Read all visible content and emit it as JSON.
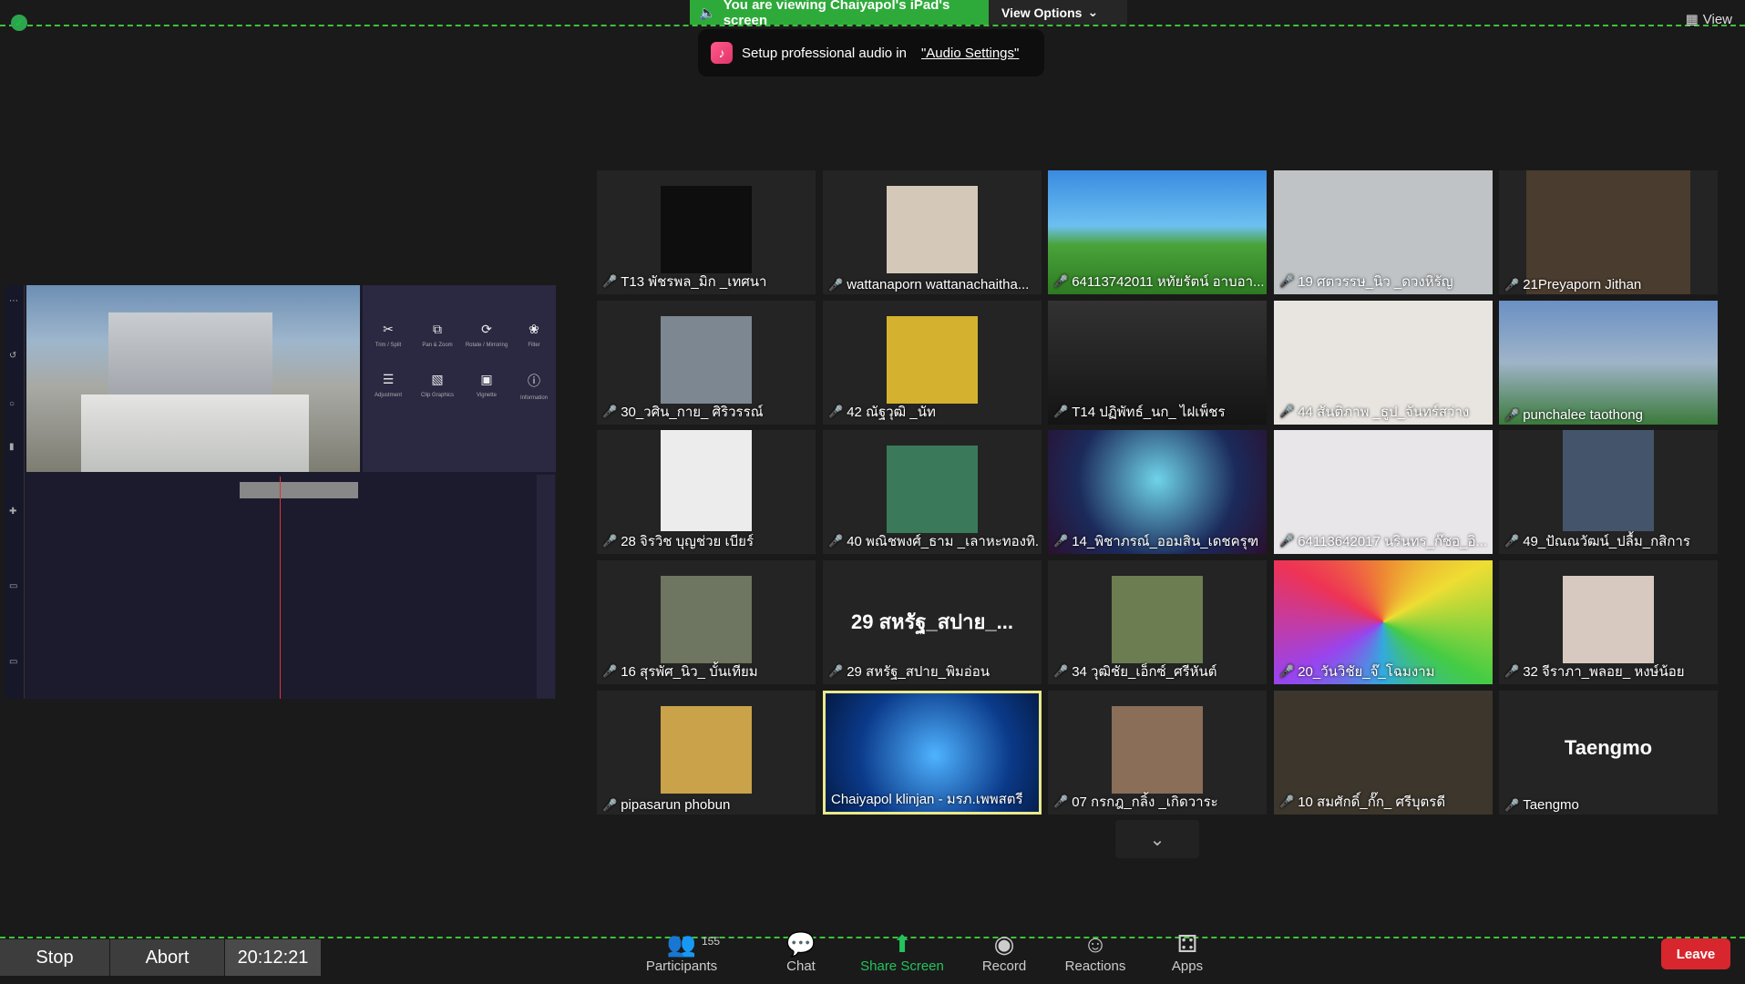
{
  "banner": {
    "viewing": "You are viewing Chaiyapol's iPad's screen",
    "view_options": "View Options"
  },
  "view_button": "View",
  "toast": {
    "text": "Setup professional audio in",
    "link": "\"Audio Settings\""
  },
  "participants_grid": [
    {
      "name": "T13 พัชรพล_มิก _เทศนา",
      "muted": true
    },
    {
      "name": "wattanaporn wattanachaitha...",
      "muted": true
    },
    {
      "name": "64113742011 หทัยรัตน์ อาบอา...",
      "muted": true
    },
    {
      "name": "19 ศตวรรษ_นิว _ดวงหิรัญ",
      "muted": true
    },
    {
      "name": "21Preyaporn Jithan",
      "muted": true
    },
    {
      "name": "30_วศิน_กาย_ ศิริวรรณ์",
      "muted": true
    },
    {
      "name": "42 ณัฐวุฒิ _นัท",
      "muted": true
    },
    {
      "name": "T14 ปฏิพัทธ์_นก_ ไฝเพ็ชร",
      "muted": true
    },
    {
      "name": "44 สันติภาพ _ธูป_จันทร์สว่าง",
      "muted": true
    },
    {
      "name": "punchalee taothong",
      "muted": true
    },
    {
      "name": "28 จิรวิช บุญช่วย เบียร์",
      "muted": true
    },
    {
      "name": "40 พณิชพงศ์_ธาม _เลาหะทองทิ...",
      "muted": true
    },
    {
      "name": "14_พิชาภรณ์_ออมสิน_เดชครุฑ",
      "muted": true
    },
    {
      "name": "64113642017 นรินทร_ก๊ชอ_อิ...",
      "muted": true
    },
    {
      "name": "49_ปัณณวัฒน์_ปลื้ม_กสิการ",
      "muted": true
    },
    {
      "name": "16 สุรพัศ_นิว_ บั้นเทียม",
      "muted": true
    },
    {
      "name": "29 สหรัฐ_สปาย_พิมอ่อน",
      "muted": true,
      "big": "29 สหรัฐ_สปาย_..."
    },
    {
      "name": "34 วุฒิชัย_เอ็กซ์_ศรีหันต์",
      "muted": true
    },
    {
      "name": "20_วันวิชัย_จ๊_โฉมงาม",
      "muted": true
    },
    {
      "name": "32 จีราภา_พลอย_ หงษ์น้อย",
      "muted": true
    },
    {
      "name": "pipasarun phobun",
      "muted": true
    },
    {
      "name": "Chaiyapol klinjan - มรภ.เพพสตรี",
      "muted": false
    },
    {
      "name": "07 กรกฎ_กลิ้ง _เกิดวาระ",
      "muted": true
    },
    {
      "name": "10 สมศักดิ์_กั๊ก_ ศรีบุตรดี",
      "muted": true
    },
    {
      "name": "Taengmo",
      "muted": true,
      "big": "Taengmo"
    }
  ],
  "recording": {
    "stop": "Stop",
    "abort": "Abort",
    "time": "20:12:21"
  },
  "toolbar": {
    "participants_count": "155",
    "participants": "Participants",
    "chat": "Chat",
    "share_screen": "Share Screen",
    "record": "Record",
    "reactions": "Reactions",
    "apps": "Apps",
    "leave": "Leave"
  },
  "colors": {
    "share_green": "#2eaa3a",
    "leave_red": "#d8262e",
    "active_speaker": "#eae98a",
    "muted_red": "#e23a3a"
  }
}
